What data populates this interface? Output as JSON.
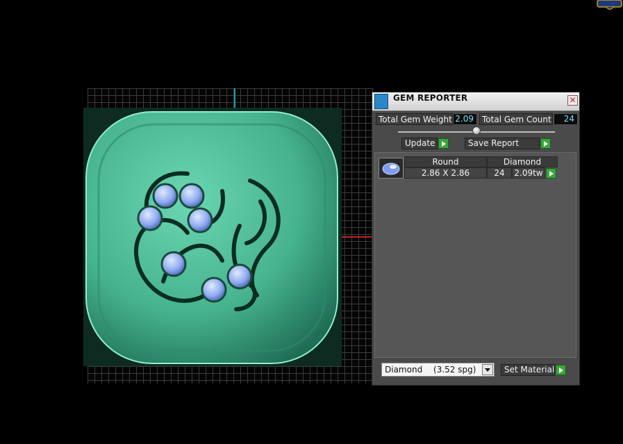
{
  "gem_reporter": {
    "title": "GEM REPORTER",
    "total_gem_weight_label": "Total Gem Weight",
    "total_gem_weight_value": "2.09",
    "total_gem_count_label": "Total Gem Count",
    "total_gem_count_value": "24",
    "update_label": "Update",
    "save_report_label": "Save Report",
    "table": {
      "headers": [
        "Round",
        "Diamond"
      ],
      "rows": [
        {
          "size": "2.86 X 2.86",
          "count": "24",
          "weight": "2.09tw"
        }
      ]
    },
    "material_select": {
      "name": "Diamond",
      "spg": "(3.52 spg)"
    },
    "set_material_label": "Set Material"
  },
  "colors": {
    "model": "#4fbd98",
    "gem": "#8fb0f0",
    "axis_x": "#c81e1e",
    "axis_y": "#1aa0a8",
    "go_button": "#3aa63a"
  }
}
